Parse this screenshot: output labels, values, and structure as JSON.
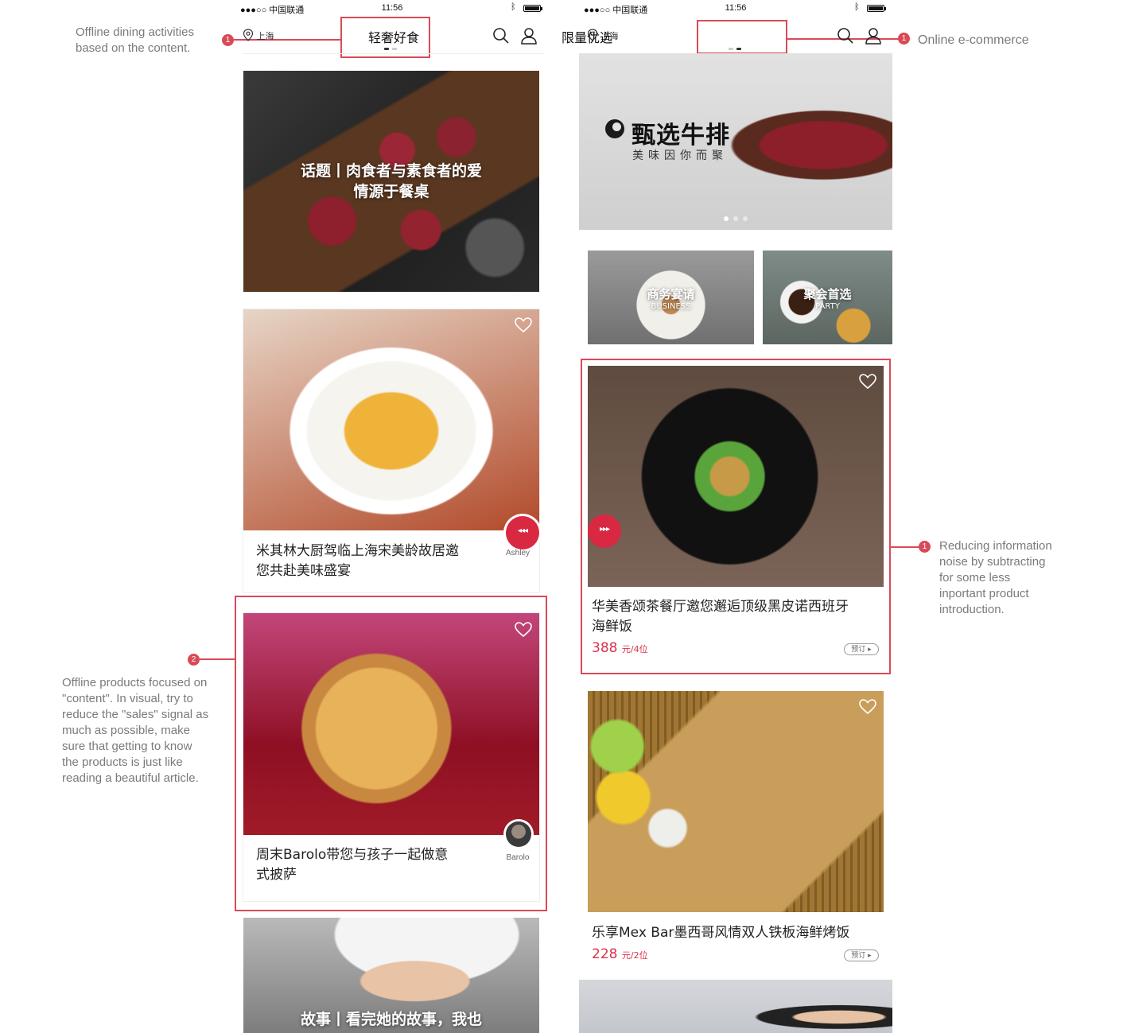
{
  "annotations": {
    "top_left": {
      "num": "1",
      "text_line1": "Offline dining activities",
      "text_line2": "based on the content."
    },
    "top_right": {
      "num": "1",
      "text": "Online e-commerce"
    },
    "middle_right": {
      "num": "1",
      "lines": [
        "Reducing information",
        "noise by subtracting",
        "for some less",
        "inportant product",
        "introduction."
      ]
    },
    "bottom_left": {
      "num": "2",
      "lines": [
        "Offline products focused on",
        "\"content\". In visual, try to",
        "reduce the \"sales\" signal as",
        "much as possible, make",
        "sure that getting to know",
        "the products is just like",
        "reading a beautiful article."
      ]
    }
  },
  "left_phone": {
    "status": {
      "carrier": "●●●○○ 中国联通",
      "time": "11:56"
    },
    "nav": {
      "location": "上海",
      "title": "轻奢好食"
    },
    "hero": {
      "line1": "话题丨肉食者与素食者的爱",
      "line2": "情源于餐桌"
    },
    "card1": {
      "title_line1": "米其林大厨驾临上海宋美龄故居邀",
      "title_line2": "您共赴美味盛宴",
      "author": "Ashley"
    },
    "card2": {
      "title_line1": "周末Barolo带您与孩子一起做意",
      "title_line2": "式披萨",
      "author": "Barolo"
    },
    "card3": {
      "title_line1": "故事丨看完她的故事，我也"
    }
  },
  "right_phone": {
    "status": {
      "carrier": "●●●○○ 中国联通",
      "time": "11:56"
    },
    "nav": {
      "location": "上海",
      "title": "限量优选"
    },
    "banner": {
      "brand": "甄选牛排",
      "slogan": "美味因你而聚"
    },
    "category1": {
      "cn": "商务宴请",
      "en": "BUSINESS"
    },
    "category2": {
      "cn": "聚会首选",
      "en": "PARTY"
    },
    "product1": {
      "title_line1": "华美香颂茶餐厅邀您邂逅顶级黑皮诺西班牙",
      "title_line2": "海鲜饭",
      "price": "388",
      "unit": "元/4位",
      "button": "预订"
    },
    "product2": {
      "title": "乐享Mex Bar墨西哥风情双人铁板海鲜烤饭",
      "price": "228",
      "unit": "元/2位",
      "button": "预订"
    }
  },
  "colors": {
    "accent": "#d94a57",
    "price": "#d9324a"
  }
}
